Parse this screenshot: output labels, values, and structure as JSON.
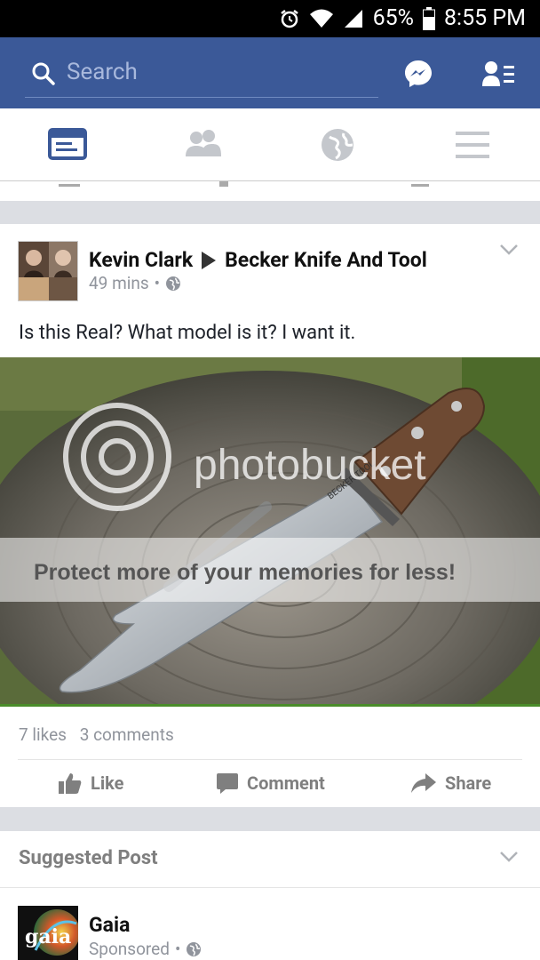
{
  "status_bar": {
    "battery": "65%",
    "time": "8:55 PM"
  },
  "top_bar": {
    "search_placeholder": "Search"
  },
  "post": {
    "author": "Kevin Clark",
    "target": "Becker Knife And Tool",
    "time": "49 mins",
    "text": "Is this Real? What model is it? I want it.",
    "watermark_brand": "photobucket",
    "watermark_tagline": "Protect more of your memories for less!",
    "knife_engraving": "BECKER TOOL",
    "likes": "7 likes",
    "comments": "3 comments",
    "actions": {
      "like": "Like",
      "comment": "Comment",
      "share": "Share"
    }
  },
  "suggested": {
    "heading": "Suggested Post",
    "page": "Gaia",
    "meta": "Sponsored",
    "logo_text": "gaia"
  },
  "colors": {
    "brand": "#3b5998",
    "active_tab": "#3b5998"
  }
}
